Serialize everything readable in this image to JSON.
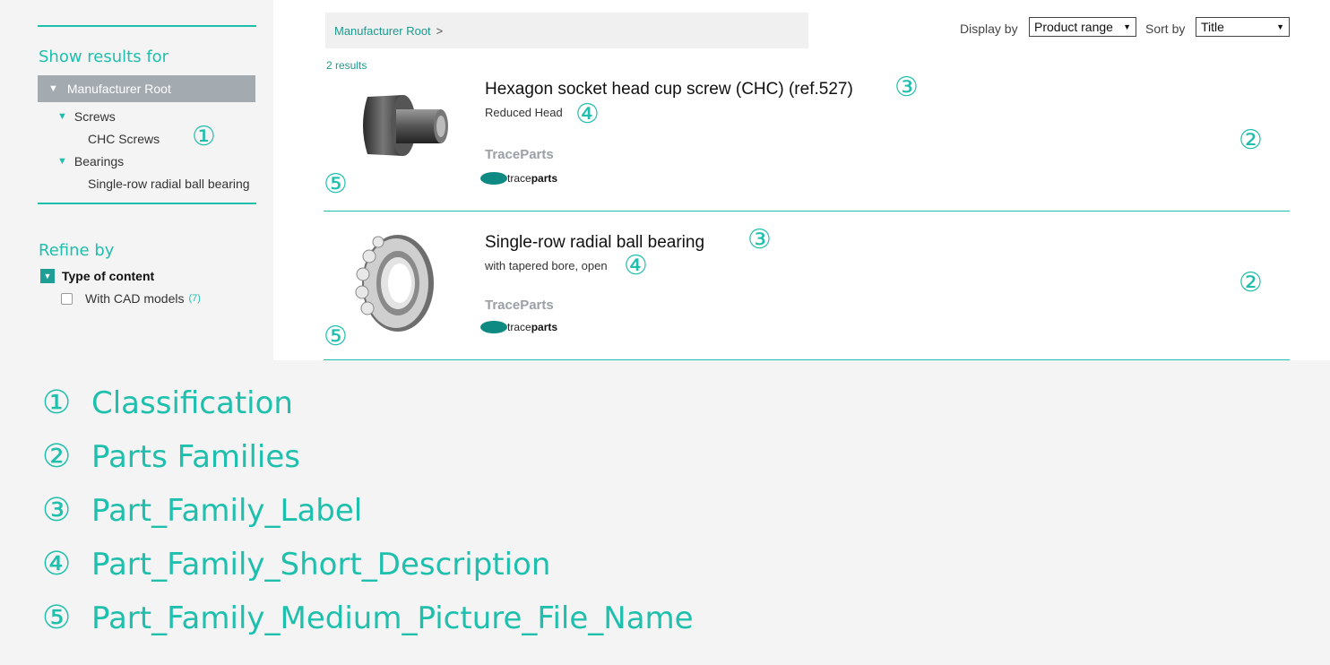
{
  "colors": {
    "accent": "#1fbfad",
    "accent_dark": "#1a9a8e",
    "root_bg": "#a3abb0",
    "logo": "#0f8a83"
  },
  "sidebar": {
    "show_results_heading": "Show results for",
    "root_label": "Manufacturer Root",
    "tree": [
      {
        "label": "Screws",
        "type": "group"
      },
      {
        "label": "CHC Screws",
        "type": "leaf"
      },
      {
        "label": "Bearings",
        "type": "group"
      },
      {
        "label": "Single-row radial ball bearing",
        "type": "leaf"
      }
    ],
    "refine_heading": "Refine by",
    "filter_group": "Type of content",
    "filter_option": "With CAD models",
    "filter_count": "(7)"
  },
  "header": {
    "breadcrumb_root": "Manufacturer Root",
    "breadcrumb_sep": ">",
    "display_by_label": "Display by",
    "display_by_value": "Product range",
    "sort_by_label": "Sort by",
    "sort_by_value": "Title"
  },
  "results_count": "2 results",
  "results": [
    {
      "title": "Hexagon socket head cup screw (CHC) (ref.527)",
      "description": "Reduced Head",
      "brand": "TraceParts",
      "logo_text_a": "trace",
      "logo_text_b": "parts",
      "image_icon": "screw-image"
    },
    {
      "title": "Single-row radial ball bearing",
      "description": "with tapered bore, open",
      "brand": "TraceParts",
      "logo_text_a": "trace",
      "logo_text_b": "parts",
      "image_icon": "bearing-image"
    }
  ],
  "markers": {
    "m1": "①",
    "m2": "②",
    "m3": "③",
    "m4": "④",
    "m5": "⑤"
  },
  "legend": [
    {
      "num": "①",
      "text": "Classification"
    },
    {
      "num": "②",
      "text": "Parts Families"
    },
    {
      "num": "③",
      "text": "Part_Family_Label"
    },
    {
      "num": "④",
      "text": "Part_Family_Short_Description"
    },
    {
      "num": "⑤",
      "text": "Part_Family_Medium_Picture_File_Name"
    }
  ]
}
